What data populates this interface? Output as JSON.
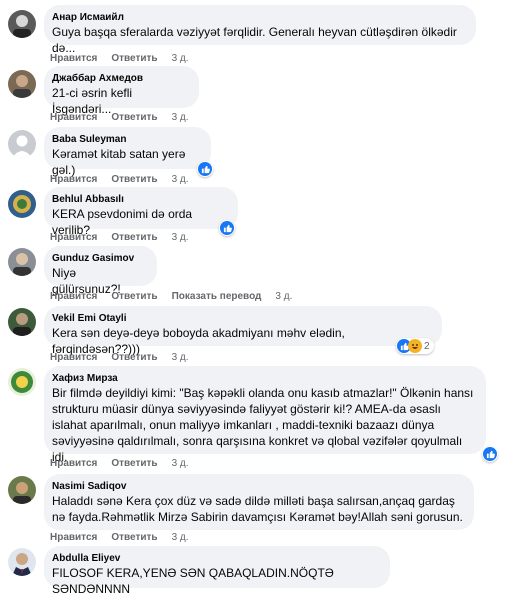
{
  "actions": {
    "like": "Нравится",
    "reply": "Ответить",
    "translation": "Показать перевод"
  },
  "comments": [
    {
      "author": "Анар Исмаийл",
      "text": "Guya başqa sferalarda vəziyyət fərqlidir. Generalı heyvan cütləşdirən ölkədir də...",
      "time": "3 д."
    },
    {
      "author": "Джаббар Ахмедов",
      "text": "21-ci əsrin kefli İsgəndəri...",
      "time": "3 д."
    },
    {
      "author": "Baba Suleyman",
      "text": "Kəramət kitab satan yerə gəl.)",
      "time": "3 д."
    },
    {
      "author": "Behlul Abbasılı",
      "text": "KERA psevdonimi də orda verilib?",
      "time": "3 д."
    },
    {
      "author": "Gunduz Gasimov",
      "text": "Niyə gülürsunuz?!",
      "time": "3 д."
    },
    {
      "author": "Vekil Emi Otayli",
      "text": "Kera sən deyə-deyə boboyda akadmiyanı məhv elədin, fərqindəsən??)))",
      "time": "3 д.",
      "reaction_count": "2"
    },
    {
      "author": "Хафиз Мирза",
      "text": "Bir filmdə deyildiyi kimi: \"Baş kəpəkli olanda onu kasıb atmazlar!\" Ölkənin hansı strukturu müasir dünya səviyyəsində faliyyət göstərir ki!? AMEA-da əsaslı islahat aparılmalı, onun maliyyə imkanları , maddi-texniki bazaazı dünya səviyyəsinə qaldırılmalı, sonra qarşısına konkret və qlobal vəzifələr qoyulmalı idi.",
      "time": "3 д."
    },
    {
      "author": "Nasimi Sadiqov",
      "text": "Haladdı sənə Kera çox düz və sadə dildə milləti başa salırsan,ançaq gardaş nə fayda.Rəhmətlik Mirzə Sabirin davamçısı Kəramət bəy!Allah səni gorusun.",
      "time": "3 д."
    },
    {
      "author": "Abdulla Eliyev",
      "text": "FILOSOF KERA,YENƏ SƏN QABAQLADIN.NÖQTƏ SƏNDƏNNNN",
      "time": ""
    }
  ],
  "colors": {
    "bubble": "#f0f2f5",
    "meta": "#65676b",
    "like_blue": "#1877f2"
  }
}
